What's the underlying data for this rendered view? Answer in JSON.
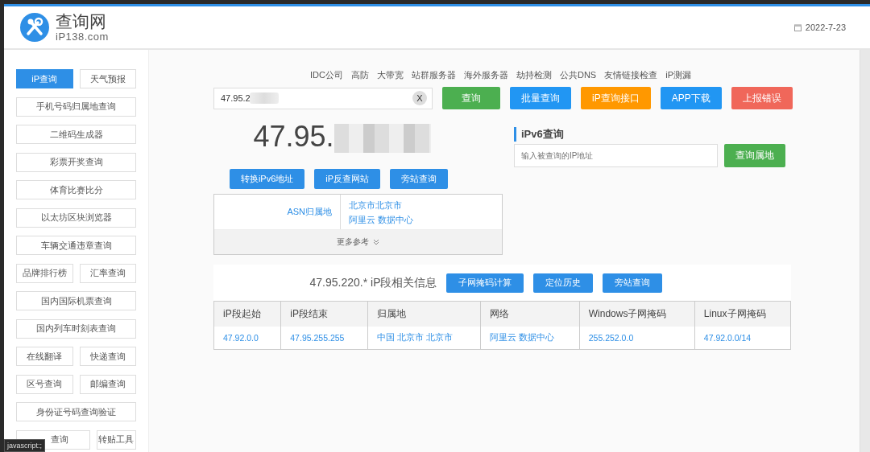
{
  "header": {
    "logo_title": "查询网",
    "logo_subtitle": "iP138.com",
    "date": "2022-7-23"
  },
  "sidebar": {
    "rows": [
      [
        {
          "label": "iP查询",
          "selected": true,
          "covered": false
        },
        {
          "label": "天气预报",
          "selected": false,
          "covered": false
        }
      ],
      [
        {
          "label": "手机号码归属地查询",
          "selected": false,
          "covered": false
        }
      ],
      [
        {
          "label": "二维码生成器",
          "selected": false,
          "covered": false
        }
      ],
      [
        {
          "label": "彩票开奖查询",
          "selected": false,
          "covered": false
        }
      ],
      [
        {
          "label": "体育比赛比分",
          "selected": false,
          "covered": false
        }
      ],
      [
        {
          "label": "以太坊区块浏览器",
          "selected": false,
          "covered": false
        }
      ],
      [
        {
          "label": "车辆交通违章查询",
          "selected": false,
          "covered": false
        }
      ],
      [
        {
          "label": "品牌排行榜",
          "selected": false,
          "covered": false
        },
        {
          "label": "汇率查询",
          "selected": false,
          "covered": false
        }
      ],
      [
        {
          "label": "国内国际机票查询",
          "selected": false,
          "covered": false
        }
      ],
      [
        {
          "label": "国内列车时刻表查询",
          "selected": false,
          "covered": false
        }
      ],
      [
        {
          "label": "在线翻译",
          "selected": false,
          "covered": false
        },
        {
          "label": "快递查询",
          "selected": false,
          "covered": false
        }
      ],
      [
        {
          "label": "区号查询",
          "selected": false,
          "covered": false
        },
        {
          "label": "邮编查询",
          "selected": false,
          "covered": false
        }
      ],
      [
        {
          "label": "身份证号码查询验证",
          "selected": false,
          "covered": false
        }
      ],
      [
        {
          "label": "查询",
          "selected": false,
          "covered": true
        },
        {
          "label": "转贴工具",
          "selected": false,
          "covered": false
        }
      ]
    ]
  },
  "nav_links": [
    "IDC公司",
    "高防",
    "大带宽",
    "站群服务器",
    "海外服务器",
    "劫持检测",
    "公共DNS",
    "友情链接检查",
    "iP测漏"
  ],
  "search": {
    "value": "47.95.2",
    "clear": "X",
    "buttons": [
      {
        "label": "查询",
        "color": "#4caf50"
      },
      {
        "label": "批量查询",
        "color": "#2196f3"
      },
      {
        "label": "iP查询接口",
        "color": "#ff9800"
      },
      {
        "label": "APP下载",
        "color": "#2196f3"
      },
      {
        "label": "上报错误",
        "color": "#f0675a"
      }
    ]
  },
  "result": {
    "ip": "47.95.",
    "buttons": [
      "转换iPv6地址",
      "iP反查网站",
      "旁站查询"
    ],
    "asn_label": "ASN归属地",
    "asn_lines": [
      "北京市北京市",
      "阿里云 数据中心"
    ],
    "more": "更多参考"
  },
  "ipv6": {
    "title": "iPv6查询",
    "placeholder": "输入被查询的IP地址",
    "button": "查询属地"
  },
  "segment": {
    "title": "47.95.220.* iP段相关信息",
    "buttons": [
      "子网掩码计算",
      "定位历史",
      "旁站查询"
    ],
    "columns": [
      "iP段起始",
      "iP段结束",
      "归属地",
      "网络",
      "Windows子网掩码",
      "Linux子网掩码"
    ],
    "rows": [
      [
        "47.92.0.0",
        "47.95.255.255",
        "中国 北京市 北京市",
        "阿里云 数据中心",
        "255.252.0.0",
        "47.92.0.0/14"
      ]
    ]
  },
  "status_bar": {
    "text": "javascript:;"
  }
}
